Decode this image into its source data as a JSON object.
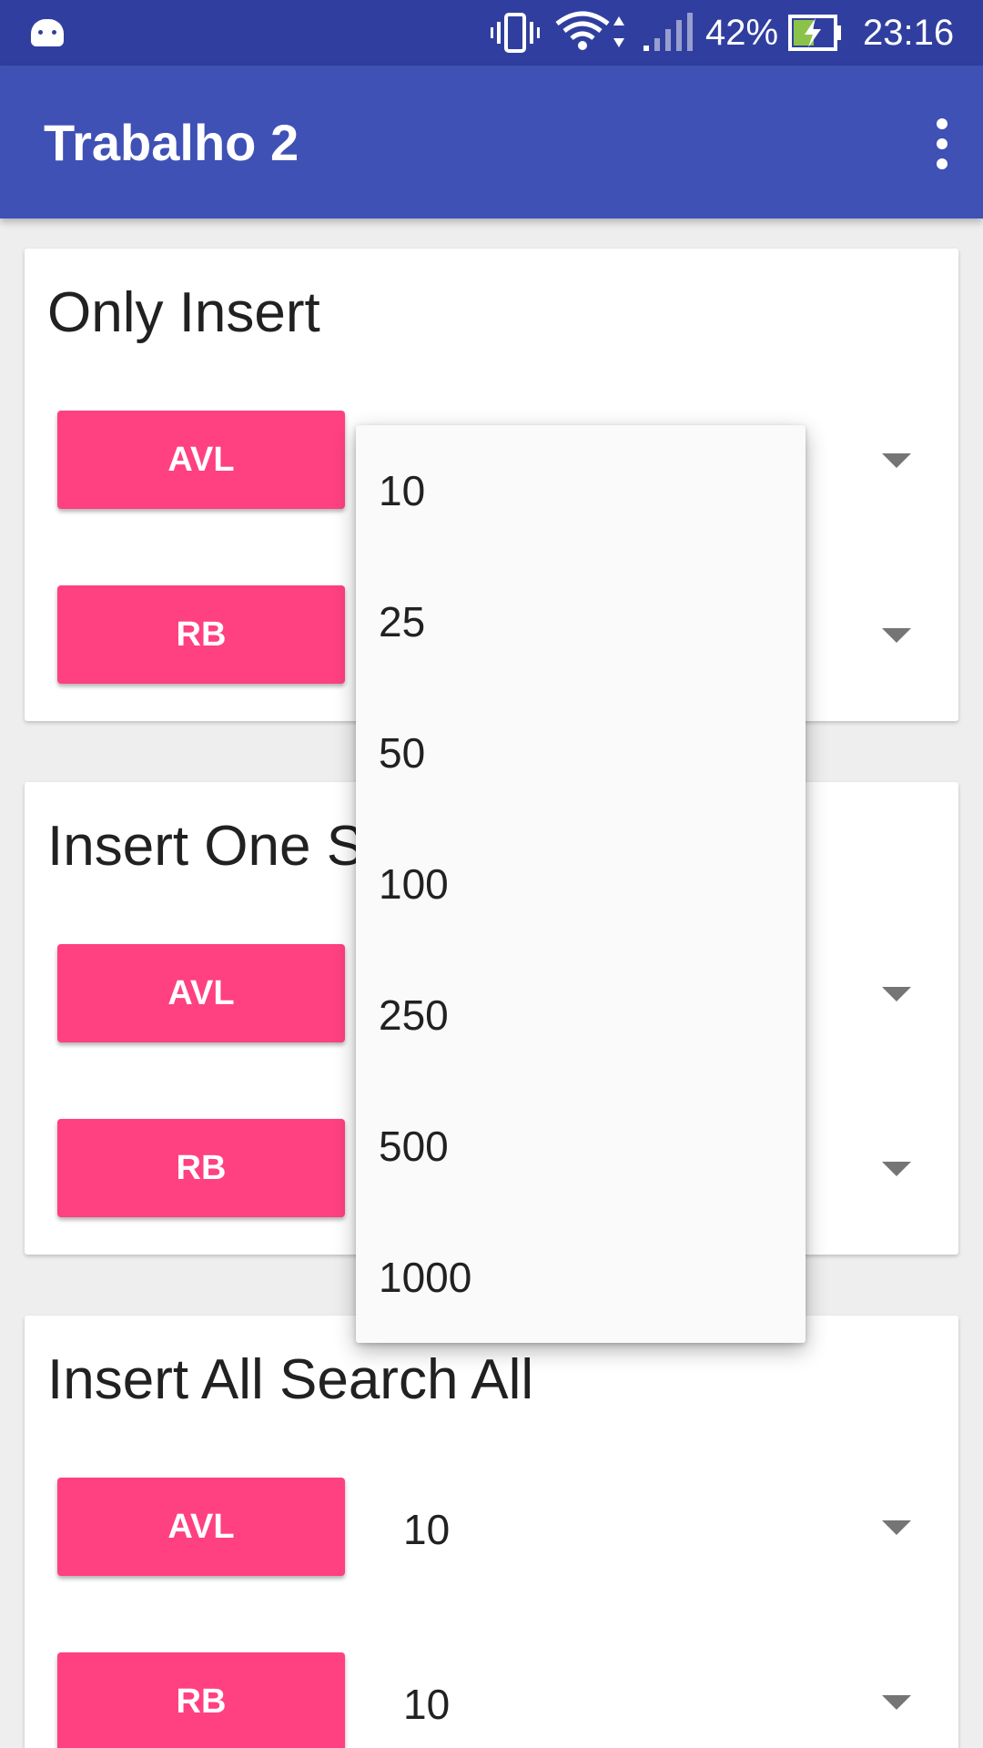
{
  "status_bar": {
    "battery": "42%",
    "time": "23:16",
    "icons": [
      "android-icon",
      "vibrate-icon",
      "wifi-icon",
      "signal-icon",
      "battery-charging-icon"
    ]
  },
  "app_bar": {
    "title": "Trabalho 2",
    "menu_icon": "more-vert-icon"
  },
  "cards": [
    {
      "title": "Only Insert",
      "rows": [
        {
          "button": "AVL",
          "value": ""
        },
        {
          "button": "RB",
          "value": ""
        }
      ]
    },
    {
      "title": "Insert One Search One",
      "rows": [
        {
          "button": "AVL",
          "value": ""
        },
        {
          "button": "RB",
          "value": ""
        }
      ]
    },
    {
      "title": "Insert All Search All",
      "rows": [
        {
          "button": "AVL",
          "value": "10"
        },
        {
          "button": "RB",
          "value": "10"
        }
      ]
    }
  ],
  "dropdown": {
    "options": [
      "10",
      "25",
      "50",
      "100",
      "250",
      "500",
      "1000"
    ]
  },
  "colors": {
    "status_bar": "#303f9f",
    "app_bar": "#3f51b5",
    "accent": "#ff4081"
  }
}
